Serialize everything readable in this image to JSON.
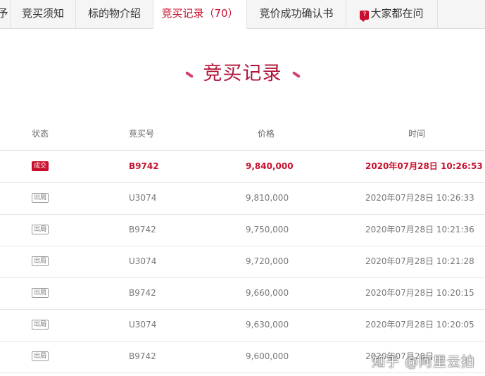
{
  "tabs": [
    {
      "label": "竞买须知",
      "active": false
    },
    {
      "label": "标的物介绍",
      "active": false
    },
    {
      "label": "竞买记录（70）",
      "active": true
    },
    {
      "label": "竞价成功确认书",
      "active": false
    },
    {
      "label": "大家都在问",
      "active": false,
      "icon": "question-bubble-icon"
    }
  ],
  "section": {
    "title": "竞买记录"
  },
  "table": {
    "headers": {
      "status": "状态",
      "bidder": "竞买号",
      "price": "价格",
      "time": "时间"
    },
    "rows": [
      {
        "status": "成交",
        "bidder": "B9742",
        "price": "9,840,000",
        "time": "2020年07月28日 10:26:53",
        "winner": true
      },
      {
        "status": "出局",
        "bidder": "U3074",
        "price": "9,810,000",
        "time": "2020年07月28日 10:26:33",
        "winner": false
      },
      {
        "status": "出局",
        "bidder": "B9742",
        "price": "9,750,000",
        "time": "2020年07月28日 10:21:36",
        "winner": false
      },
      {
        "status": "出局",
        "bidder": "U3074",
        "price": "9,720,000",
        "time": "2020年07月28日 10:21:28",
        "winner": false
      },
      {
        "status": "出局",
        "bidder": "B9742",
        "price": "9,660,000",
        "time": "2020年07月28日 10:20:15",
        "winner": false
      },
      {
        "status": "出局",
        "bidder": "U3074",
        "price": "9,630,000",
        "time": "2020年07月28日 10:20:05",
        "winner": false
      },
      {
        "status": "出局",
        "bidder": "B9742",
        "price": "9,600,000",
        "time": "2020年07月28日",
        "winner": false
      }
    ]
  },
  "watermark": {
    "text": "知乎 @阿里云拍"
  },
  "colors": {
    "accent": "#c8102e",
    "title": "#b0163a",
    "text": "#777777"
  }
}
